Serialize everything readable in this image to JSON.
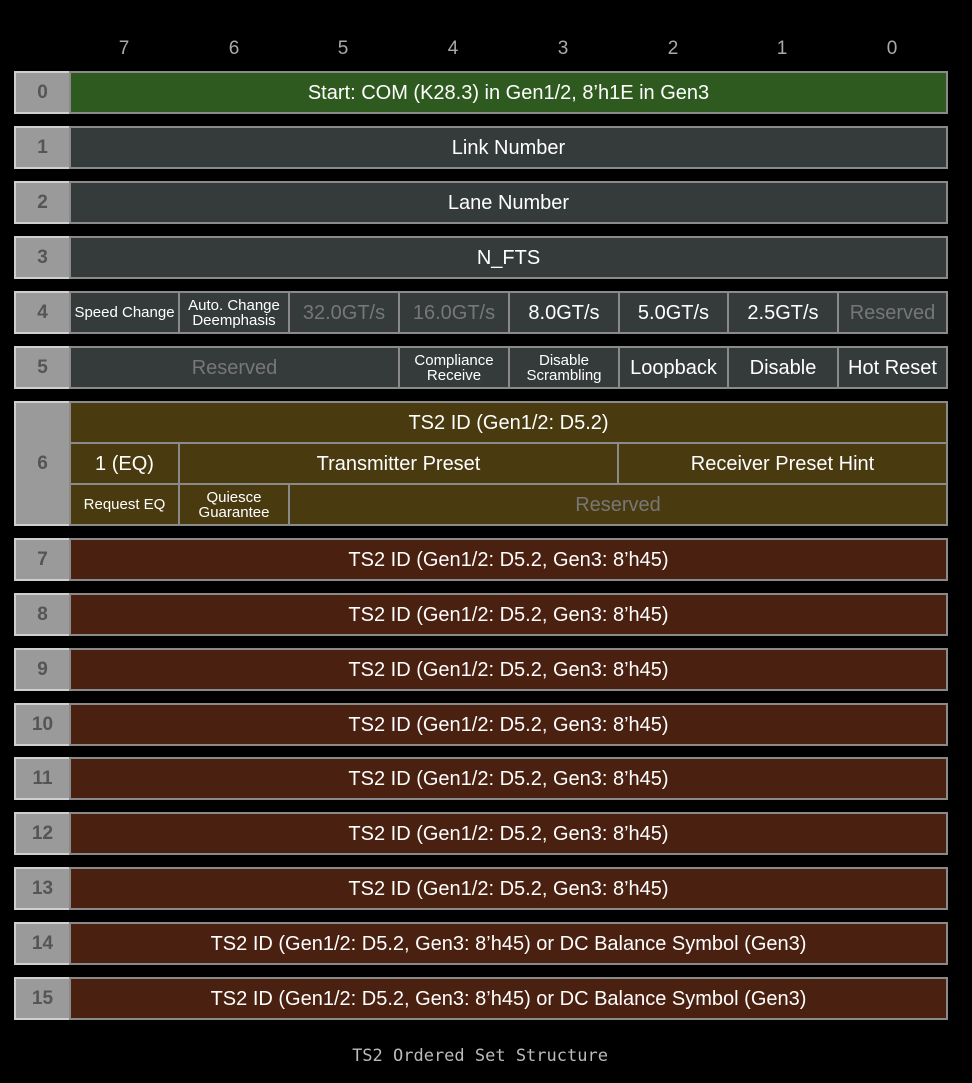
{
  "bit_header": [
    "7",
    "6",
    "5",
    "4",
    "3",
    "2",
    "1",
    "0"
  ],
  "rows": {
    "r0": {
      "idx": "0",
      "label": "Start: COM (K28.3) in Gen1/2, 8’h1E in Gen3"
    },
    "r1": {
      "idx": "1",
      "label": "Link Number"
    },
    "r2": {
      "idx": "2",
      "label": "Lane Number"
    },
    "r3": {
      "idx": "3",
      "label": "N_FTS"
    },
    "r4": {
      "idx": "4",
      "cells": [
        "Speed Change",
        "Auto. Change\nDeemphasis",
        "32.0GT/s",
        "16.0GT/s",
        "8.0GT/s",
        "5.0GT/s",
        "2.5GT/s",
        "Reserved"
      ]
    },
    "r5": {
      "idx": "5",
      "cells": [
        "Reserved",
        "Compliance\nReceive",
        "Disable\nScrambling",
        "Loopback",
        "Disable",
        "Hot Reset"
      ]
    },
    "r6": {
      "idx": "6",
      "top": "TS2 ID (Gen1/2: D5.2)",
      "mid": [
        "1 (EQ)",
        "Transmitter Preset",
        "Receiver Preset Hint"
      ],
      "bot": [
        "Request EQ",
        "Quiesce\nGuarantee",
        "Reserved"
      ]
    },
    "r7": {
      "idx": "7",
      "label": "TS2 ID (Gen1/2: D5.2, Gen3: 8’h45)"
    },
    "r8": {
      "idx": "8",
      "label": "TS2 ID (Gen1/2: D5.2, Gen3: 8’h45)"
    },
    "r9": {
      "idx": "9",
      "label": "TS2 ID (Gen1/2: D5.2, Gen3: 8’h45)"
    },
    "r10": {
      "idx": "10",
      "label": "TS2 ID (Gen1/2: D5.2, Gen3: 8’h45)"
    },
    "r11": {
      "idx": "11",
      "label": "TS2 ID (Gen1/2: D5.2, Gen3: 8’h45)"
    },
    "r12": {
      "idx": "12",
      "label": "TS2 ID (Gen1/2: D5.2, Gen3: 8’h45)"
    },
    "r13": {
      "idx": "13",
      "label": "TS2 ID (Gen1/2: D5.2, Gen3: 8’h45)"
    },
    "r14": {
      "idx": "14",
      "label": "TS2 ID (Gen1/2: D5.2, Gen3: 8’h45) or DC Balance Symbol (Gen3)"
    },
    "r15": {
      "idx": "15",
      "label": "TS2 ID (Gen1/2: D5.2, Gen3: 8’h45) or DC Balance Symbol (Gen3)"
    }
  },
  "caption": "TS2 Ordered Set Structure",
  "colors": {
    "start": "#2f5a1f",
    "field": "#353a3a",
    "symbol6": "#4a3a0f",
    "ts2id": "#4a2010",
    "index": "#9a9a9a"
  }
}
